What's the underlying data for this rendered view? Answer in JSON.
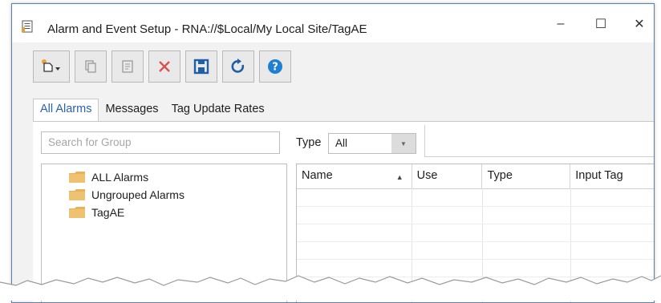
{
  "window": {
    "title": "Alarm and Event Setup - RNA://$Local/My Local Site/TagAE",
    "controls": {
      "minimize": "–",
      "maximize": "☐",
      "close": "✕"
    }
  },
  "toolbar": {
    "buttons": [
      {
        "icon": "new-dropdown-icon"
      },
      {
        "icon": "copy-icon"
      },
      {
        "icon": "properties-icon"
      },
      {
        "icon": "delete-icon"
      },
      {
        "icon": "save-icon"
      },
      {
        "icon": "refresh-icon"
      },
      {
        "icon": "help-icon"
      }
    ]
  },
  "tabs": [
    {
      "label": "All Alarms",
      "active": true
    },
    {
      "label": "Messages",
      "active": false
    },
    {
      "label": "Tag Update Rates",
      "active": false
    }
  ],
  "search": {
    "placeholder": "Search for Group"
  },
  "type_filter": {
    "label": "Type",
    "value": "All"
  },
  "tree": {
    "items": [
      {
        "label": "ALL Alarms",
        "icon": "folder-icon"
      },
      {
        "label": "Ungrouped Alarms",
        "icon": "folder-icon"
      },
      {
        "label": "TagAE",
        "icon": "folder-icon"
      }
    ]
  },
  "grid": {
    "columns": [
      "Name",
      "Use",
      "Type",
      "Input Tag"
    ],
    "sorted_column": "Name",
    "sort_direction": "ascending"
  },
  "colors": {
    "accent": "#2a62b0",
    "folder": "#e8b25a",
    "delete_red": "#d9534f",
    "toolbar_blue": "#1f5fa8"
  }
}
